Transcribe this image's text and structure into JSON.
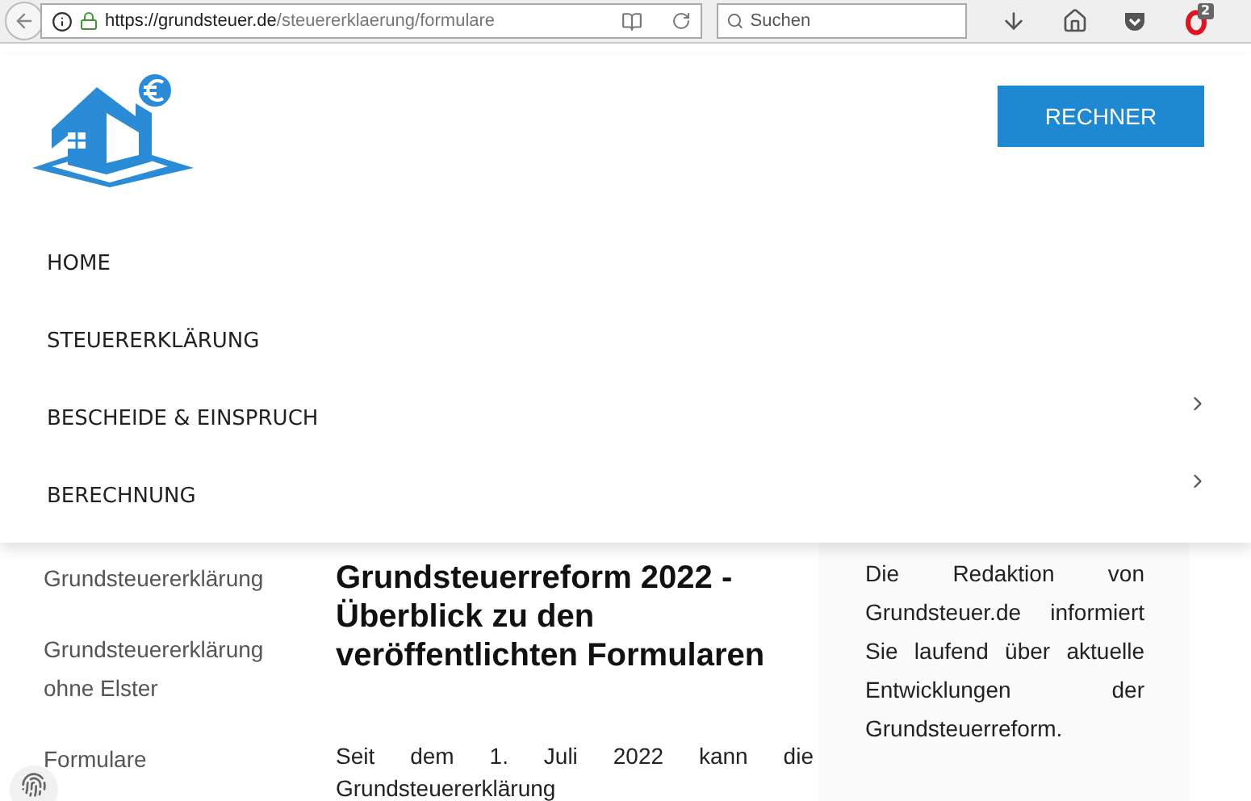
{
  "browser": {
    "url_host": "https://grundsteuer.de",
    "url_path": "/steuererklaerung/formulare",
    "search": {
      "placeholder": "Suchen"
    },
    "badge": "2"
  },
  "header": {
    "button": "RECHNER"
  },
  "menu": [
    {
      "label": "HOME",
      "has_submenu": false
    },
    {
      "label": "STEUERERKLÄRUNG",
      "has_submenu": false
    },
    {
      "label": "BESCHEIDE & EINSPRUCH",
      "has_submenu": true
    },
    {
      "label": "BERECHNUNG",
      "has_submenu": true
    }
  ],
  "sidebar_links": [
    "Grundsteuererklärung",
    "Grundsteuererklärung ohne Elster",
    "Formulare"
  ],
  "article": {
    "title": "Grundsteuerreform 2022 - Überblick zu den veröffentlichten Formularen",
    "intro": "Seit dem 1. Juli 2022 kann die Grundsteuererklärung"
  },
  "aside": {
    "text": "Die Redaktion von Grundsteuer.de informiert Sie laufend über aktuelle Entwicklungen der Grundsteuerreform."
  }
}
